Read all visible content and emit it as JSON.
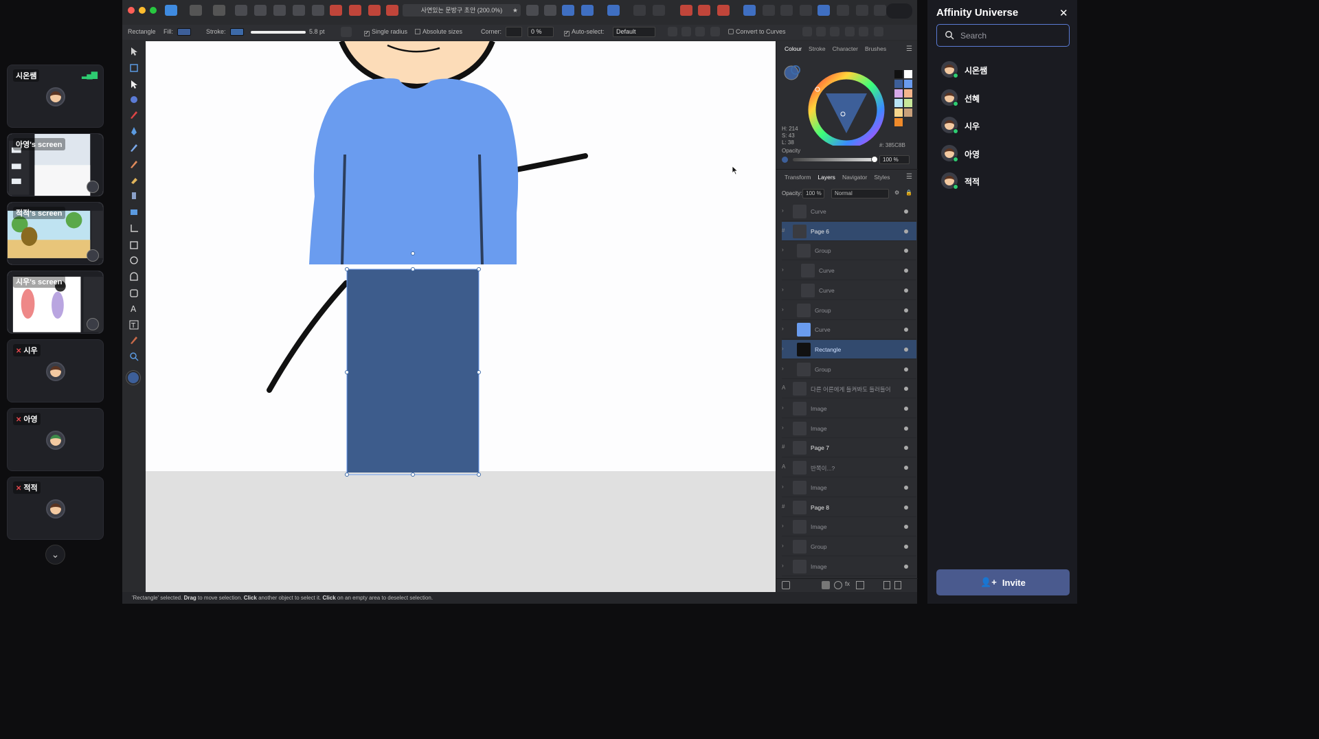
{
  "participants": [
    {
      "name": "시온쌤",
      "type": "user",
      "muted": false,
      "speaking": true
    },
    {
      "name": "아영's screen",
      "type": "screen"
    },
    {
      "name": "적적's screen",
      "type": "screen"
    },
    {
      "name": "시우's screen",
      "type": "screen"
    },
    {
      "name": "시우",
      "type": "user",
      "muted": true
    },
    {
      "name": "아영",
      "type": "user",
      "muted": true
    },
    {
      "name": "적적",
      "type": "user",
      "muted": true
    }
  ],
  "titlebar": {
    "doc_title": "사연있는 문방구 초안 (200.0%)"
  },
  "context": {
    "tool_name": "Rectangle",
    "fill_label": "Fill:",
    "stroke_label": "Stroke:",
    "stroke_width": "5.8 pt",
    "single_radius": "Single radius",
    "absolute_sizes": "Absolute sizes",
    "corner_label": "Corner:",
    "corner_value": "0 %",
    "auto_select": "Auto-select:",
    "auto_select_value": "Default",
    "convert_curves": "Convert to Curves"
  },
  "colors": {
    "fill": "#3D5F99",
    "stroke": "#3D6AA8",
    "shirt": "#6A9CEF",
    "pants": "#3D5C8C",
    "accent": "#5B7BD5"
  },
  "colour_panel": {
    "tabs": [
      "Colour",
      "Stroke",
      "Character",
      "Brushes"
    ],
    "active_tab": "Colour",
    "h": "H: 214",
    "s": "S: 43",
    "l": "L: 38",
    "opacity_label": "Opacity",
    "opacity_value": "100 %",
    "hex": "#: 385C8B"
  },
  "layers_panel": {
    "tabs": [
      "Transform",
      "Layers",
      "Navigator",
      "Styles"
    ],
    "active_tab": "Layers",
    "opacity_label": "Opacity:",
    "opacity_value": "100 %",
    "blend_mode": "Normal",
    "items": [
      {
        "name": "Curve",
        "indent": 0,
        "kind": "curve",
        "bold": false,
        "selected": false
      },
      {
        "name": "Page 6",
        "indent": 0,
        "kind": "page",
        "bold": true,
        "selected": true
      },
      {
        "name": "Group",
        "indent": 1,
        "kind": "group",
        "bold": false,
        "selected": false
      },
      {
        "name": "Curve",
        "indent": 2,
        "kind": "curve",
        "bold": false,
        "selected": false
      },
      {
        "name": "Curve",
        "indent": 2,
        "kind": "curve",
        "bold": false,
        "selected": false
      },
      {
        "name": "Group",
        "indent": 1,
        "kind": "group",
        "bold": false,
        "selected": false
      },
      {
        "name": "Curve",
        "indent": 1,
        "kind": "curve",
        "bold": false,
        "selected": false
      },
      {
        "name": "Rectangle",
        "indent": 1,
        "kind": "rect",
        "bold": false,
        "selected": true
      },
      {
        "name": "Group",
        "indent": 1,
        "kind": "group",
        "bold": false,
        "selected": false
      },
      {
        "name": "다른 어른에게 들켜봐도 들러들어",
        "indent": 0,
        "kind": "text",
        "bold": false,
        "selected": false
      },
      {
        "name": "Image",
        "indent": 0,
        "kind": "image",
        "bold": false,
        "selected": false
      },
      {
        "name": "Image",
        "indent": 0,
        "kind": "image",
        "bold": false,
        "selected": false
      },
      {
        "name": "Page 7",
        "indent": 0,
        "kind": "page",
        "bold": true,
        "selected": false
      },
      {
        "name": "반쪽이...?",
        "indent": 0,
        "kind": "text",
        "bold": false,
        "selected": false
      },
      {
        "name": "Image",
        "indent": 0,
        "kind": "image",
        "bold": false,
        "selected": false
      },
      {
        "name": "Page 8",
        "indent": 0,
        "kind": "page",
        "bold": true,
        "selected": false
      },
      {
        "name": "Image",
        "indent": 0,
        "kind": "image",
        "bold": false,
        "selected": false
      },
      {
        "name": "Group",
        "indent": 0,
        "kind": "group",
        "bold": false,
        "selected": false
      },
      {
        "name": "Image",
        "indent": 0,
        "kind": "image",
        "bold": false,
        "selected": false
      }
    ]
  },
  "status": {
    "prefix": "'Rectangle' selected.",
    "drag": "Drag",
    "drag_text": "to move selection.",
    "click": "Click",
    "click_text": "another object to select it.",
    "click2": "Click",
    "click2_text": "on an empty area to deselect selection."
  },
  "universe": {
    "title": "Affinity Universe",
    "search_placeholder": "Search",
    "members": [
      "시온쌤",
      "선혜",
      "시우",
      "아영",
      "적적"
    ],
    "invite_label": "Invite"
  }
}
